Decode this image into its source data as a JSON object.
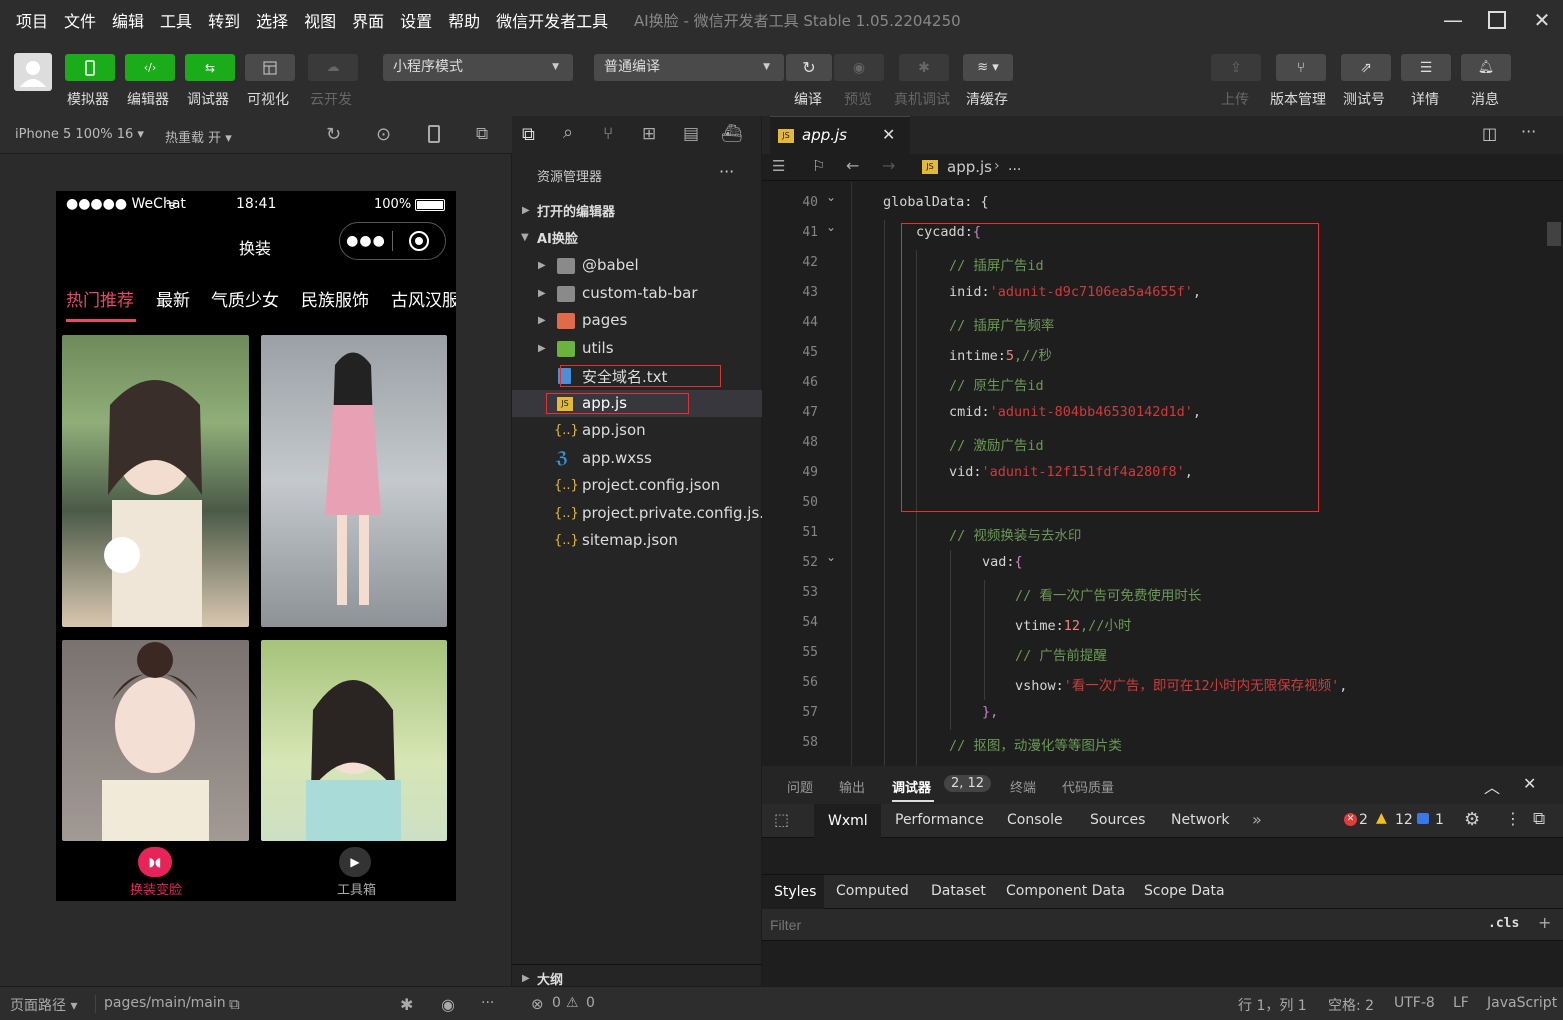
{
  "menu": [
    "项目",
    "文件",
    "编辑",
    "工具",
    "转到",
    "选择",
    "视图",
    "界面",
    "设置",
    "帮助",
    "微信开发者工具"
  ],
  "window_title": "AI换脸 - 微信开发者工具 Stable 1.05.2204250",
  "toolbar": {
    "left_buttons": [
      "模拟器",
      "编辑器",
      "调试器",
      "可视化",
      "云开发"
    ],
    "mode_select": "小程序模式",
    "compile_select": "普通编译",
    "mid_buttons": [
      "编译",
      "预览",
      "真机调试",
      "清缓存"
    ],
    "right_buttons": [
      "上传",
      "版本管理",
      "测试号",
      "详情",
      "消息"
    ]
  },
  "simulator": {
    "device": "iPhone 5 100% 16",
    "hot_reload": "热重载 开",
    "status_left": "●●●●● WeChat",
    "status_time": "18:41",
    "status_battery": "100%",
    "page_title": "换装",
    "category_tabs": [
      "热门推荐",
      "最新",
      "气质少女",
      "民族服饰",
      "古风汉服"
    ],
    "tabbar": [
      "换装变脸",
      "工具箱"
    ]
  },
  "explorer": {
    "header": "资源管理器",
    "open_editors": "打开的编辑器",
    "project": "AI换脸",
    "files": [
      "@babel",
      "custom-tab-bar",
      "pages",
      "utils",
      "安全域名.txt",
      "app.js",
      "app.json",
      "app.wxss",
      "project.config.json",
      "project.private.config.js...",
      "sitemap.json"
    ],
    "outline": "大纲"
  },
  "editor": {
    "tab": "app.js",
    "breadcrumb": "app.js",
    "breadcrumb_more": "...",
    "line_numbers": [
      "40",
      "41",
      "42",
      "43",
      "44",
      "45",
      "46",
      "47",
      "48",
      "49",
      "50",
      "51",
      "52",
      "53",
      "54",
      "55",
      "56",
      "57",
      "58"
    ],
    "l40": "globalData: {",
    "l41": "cycadd:",
    "l41b": "{",
    "l42": "// 插屏广告id",
    "l43a": "inid:",
    "l43b": "'adunit-d9c7106ea5a4655f'",
    "l44": "// 插屏广告频率",
    "l45a": "intime:",
    "l45b": "5",
    "l45c": ",//秒",
    "l46": "// 原生广告id",
    "l47a": "cmid:",
    "l47b": "'adunit-804bb46530142d1d'",
    "l48": "// 激励广告id",
    "l49a": "vid:",
    "l49b": "'adunit-12f151fdf4a280f8'",
    "l51": "// 视频换装与去水印",
    "l52a": "vad:",
    "l52b": "{",
    "l53": "// 看一次广告可免费使用时长",
    "l54a": "vtime:",
    "l54b": "12",
    "l54c": ",//小时",
    "l55": "// 广告前提醒",
    "l56a": "vshow:",
    "l56b": "'看一次广告，即可在12小时内无限保存视频'",
    "l57": "},",
    "l58": "// 抠图，动漫化等等图片类",
    "comma": ","
  },
  "debugger": {
    "tabs": [
      "问题",
      "输出",
      "调试器",
      "终端",
      "代码质量"
    ],
    "badge": "2, 12",
    "devtools_tabs": [
      "Wxml",
      "Performance",
      "Console",
      "Sources",
      "Network"
    ],
    "errors": "2",
    "warnings": "12",
    "info": "1",
    "style_tabs": [
      "Styles",
      "Computed",
      "Dataset",
      "Component Data",
      "Scope Data"
    ],
    "filter_placeholder": "Filter",
    "cls": ".cls",
    "plus": "+"
  },
  "statusbar": {
    "page_path_label": "页面路径",
    "page_path": "pages/main/main",
    "errors": "0",
    "warnings": "0",
    "position": "行 1，列 1",
    "spaces": "空格: 2",
    "encoding": "UTF-8",
    "eol": "LF",
    "language": "JavaScript"
  },
  "colors": {
    "accent_green": "#1aad19",
    "tab_active": "#e64a6a",
    "highlight_box": "#dd3333"
  }
}
